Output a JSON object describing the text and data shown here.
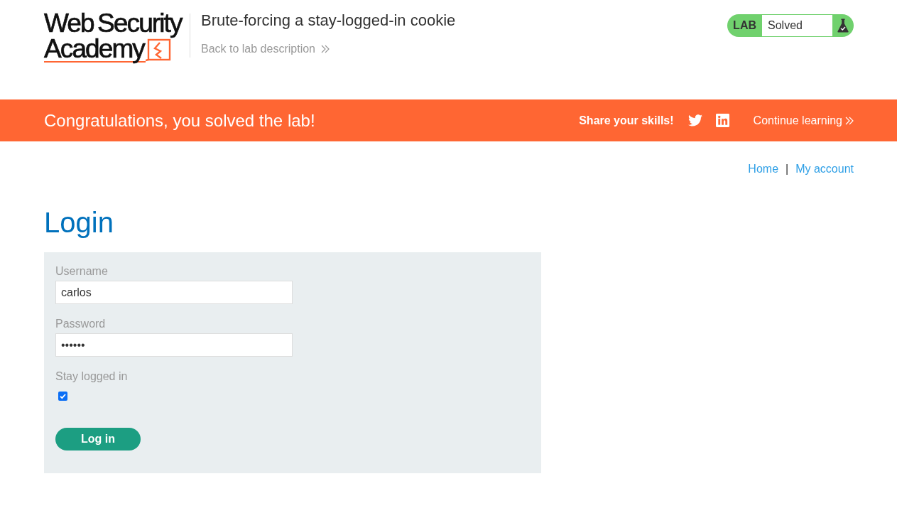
{
  "header": {
    "logo": {
      "line_1": "Web Security",
      "line_2": "Academy"
    },
    "lab_title": "Brute-forcing a stay-logged-in cookie",
    "back_link": "Back to lab description",
    "lab_status": {
      "label": "LAB",
      "status": "Solved",
      "solved": true
    }
  },
  "banner": {
    "message": "Congratulations, you solved the lab!",
    "share_label": "Share your skills!",
    "continue_link": "Continue learning"
  },
  "nav": {
    "links": [
      {
        "label": "Home"
      },
      {
        "label": "My account"
      }
    ],
    "separator": "|"
  },
  "login": {
    "heading": "Login",
    "fields": [
      {
        "label": "Username",
        "value": "carlos"
      },
      {
        "label": "Password",
        "value": "••••••"
      }
    ],
    "stay_logged_in": {
      "label": "Stay logged in",
      "checked": true
    },
    "submit": "Log in"
  }
}
